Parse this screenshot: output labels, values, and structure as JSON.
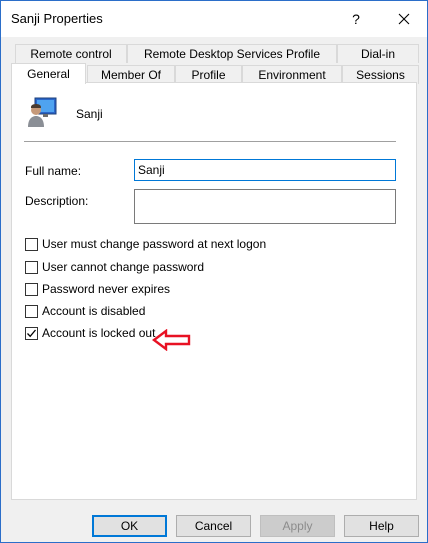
{
  "window": {
    "title": "Sanji Properties",
    "help_glyph": "?",
    "border_color": "#2b6ec9"
  },
  "tabs": {
    "row1": [
      "Remote control",
      "Remote Desktop Services Profile",
      "Dial-in"
    ],
    "row2": [
      "General",
      "Member Of",
      "Profile",
      "Environment",
      "Sessions"
    ],
    "active": "General"
  },
  "general": {
    "user_display_name": "Sanji",
    "user_icon": "user-account-icon",
    "full_name_label": "Full name:",
    "full_name_value": "Sanji",
    "description_label": "Description:",
    "description_value": "",
    "checkboxes": [
      {
        "label": "User must change password at next logon",
        "checked": false
      },
      {
        "label": "User cannot change password",
        "checked": false
      },
      {
        "label": "Password never expires",
        "checked": false
      },
      {
        "label": "Account is disabled",
        "checked": false
      },
      {
        "label": "Account is locked out",
        "checked": true
      }
    ],
    "annotation": {
      "icon": "red-arrow-left-icon",
      "color": "#e81123"
    }
  },
  "buttons": {
    "ok": "OK",
    "cancel": "Cancel",
    "apply": "Apply",
    "help": "Help"
  },
  "colors": {
    "focus_accent": "#0078d7",
    "dialog_bg": "#f0f0f0"
  }
}
